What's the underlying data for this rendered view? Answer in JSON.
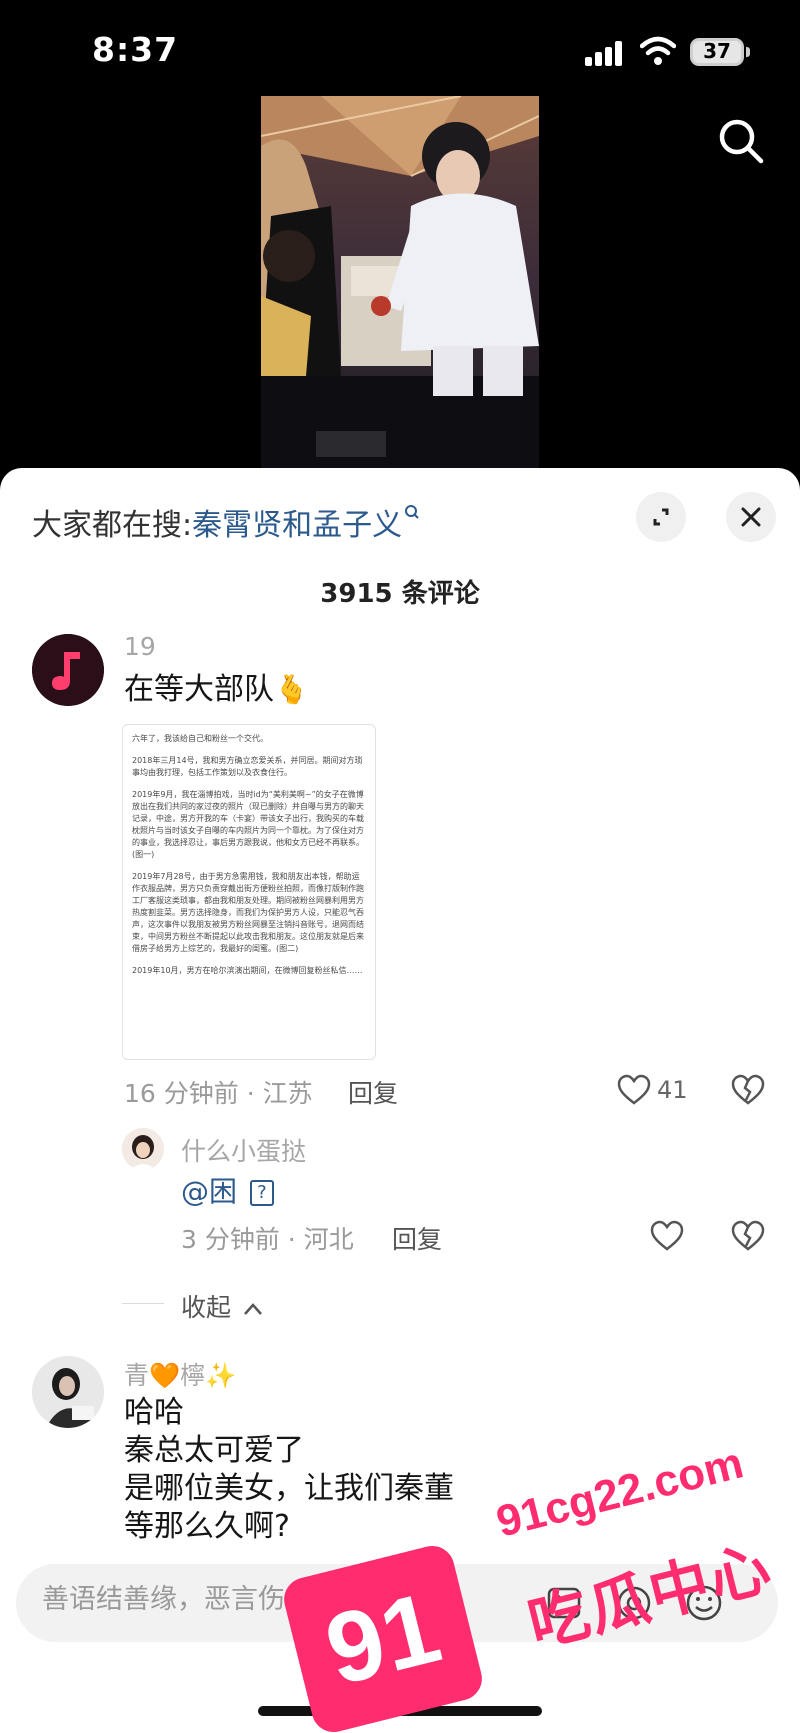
{
  "status": {
    "time": "8:37",
    "battery": "37"
  },
  "hot_search": {
    "prefix": "大家都在搜:",
    "keyword": "秦霄贤和孟子义"
  },
  "comments_count": "3915 条评论",
  "comments": [
    {
      "username": "19",
      "text": "在等大部队",
      "emoji": "🫰",
      "meta": "16 分钟前 · 江苏",
      "reply": "回复",
      "likes": "41",
      "image_paragraphs": [
        "六年了，我该给自己和粉丝一个交代。",
        "2018年三月14号，我和男方确立恋爱关系，并同居。期间对方琐事均由我打理，包括工作策划以及衣食住行。",
        "2019年9月，我在淄博拍戏，当时id为“美利美啊~”的女子在微博放出在我们共同的家过夜的照片（现已删除）并自曝与男方的聊天记录，中途，男方开我的车（卡宴）带该女子出行，我购买的车载枕照片与当时该女子自曝的车内照片为同一个靠枕。为了保住对方的事业，我选择忍让，事后男方跟我说，他和女方已经不再联系。(图一)",
        "2019年7月28号，由于男方急需用钱，我和朋友出本钱，帮助运作衣服品牌，男方只负责穿戴出街方便粉丝拍照，而像打版制作跑工厂客服这类琐事，都由我和朋友处理。期间被粉丝网暴利用男方热度割韭菜。男方选择隐身，而我们为保护男方人设，只能忍气吞声，这次事件以我朋友被男方粉丝网暴至注销抖音账号，退网而结束，中间男方粉丝不断提起以此攻击我和朋友。这位朋友就是后来借房子给男方上综艺的，我最好的闺蜜。(图二)",
        "2019年10月，男方在哈尔滨演出期间，在微博回复粉丝私信……"
      ],
      "replies": [
        {
          "username": "什么小蛋挞",
          "text": "@困",
          "meta": "3 分钟前 · 河北",
          "reply": "回复"
        }
      ],
      "collapse": "收起"
    },
    {
      "username": "青",
      "username_tail": "檸",
      "emoji_heart": "🧡",
      "emoji_sparkle": "✨",
      "lines": [
        "哈哈",
        "秦总太可爱了",
        "是哪位美女，让我们秦董",
        "等那么久啊?"
      ]
    }
  ],
  "input": {
    "placeholder": "善语结善缘，恶言伤人心"
  },
  "watermark": {
    "badge": "91",
    "domain": "91cg22.com",
    "name": "吃瓜中心"
  }
}
